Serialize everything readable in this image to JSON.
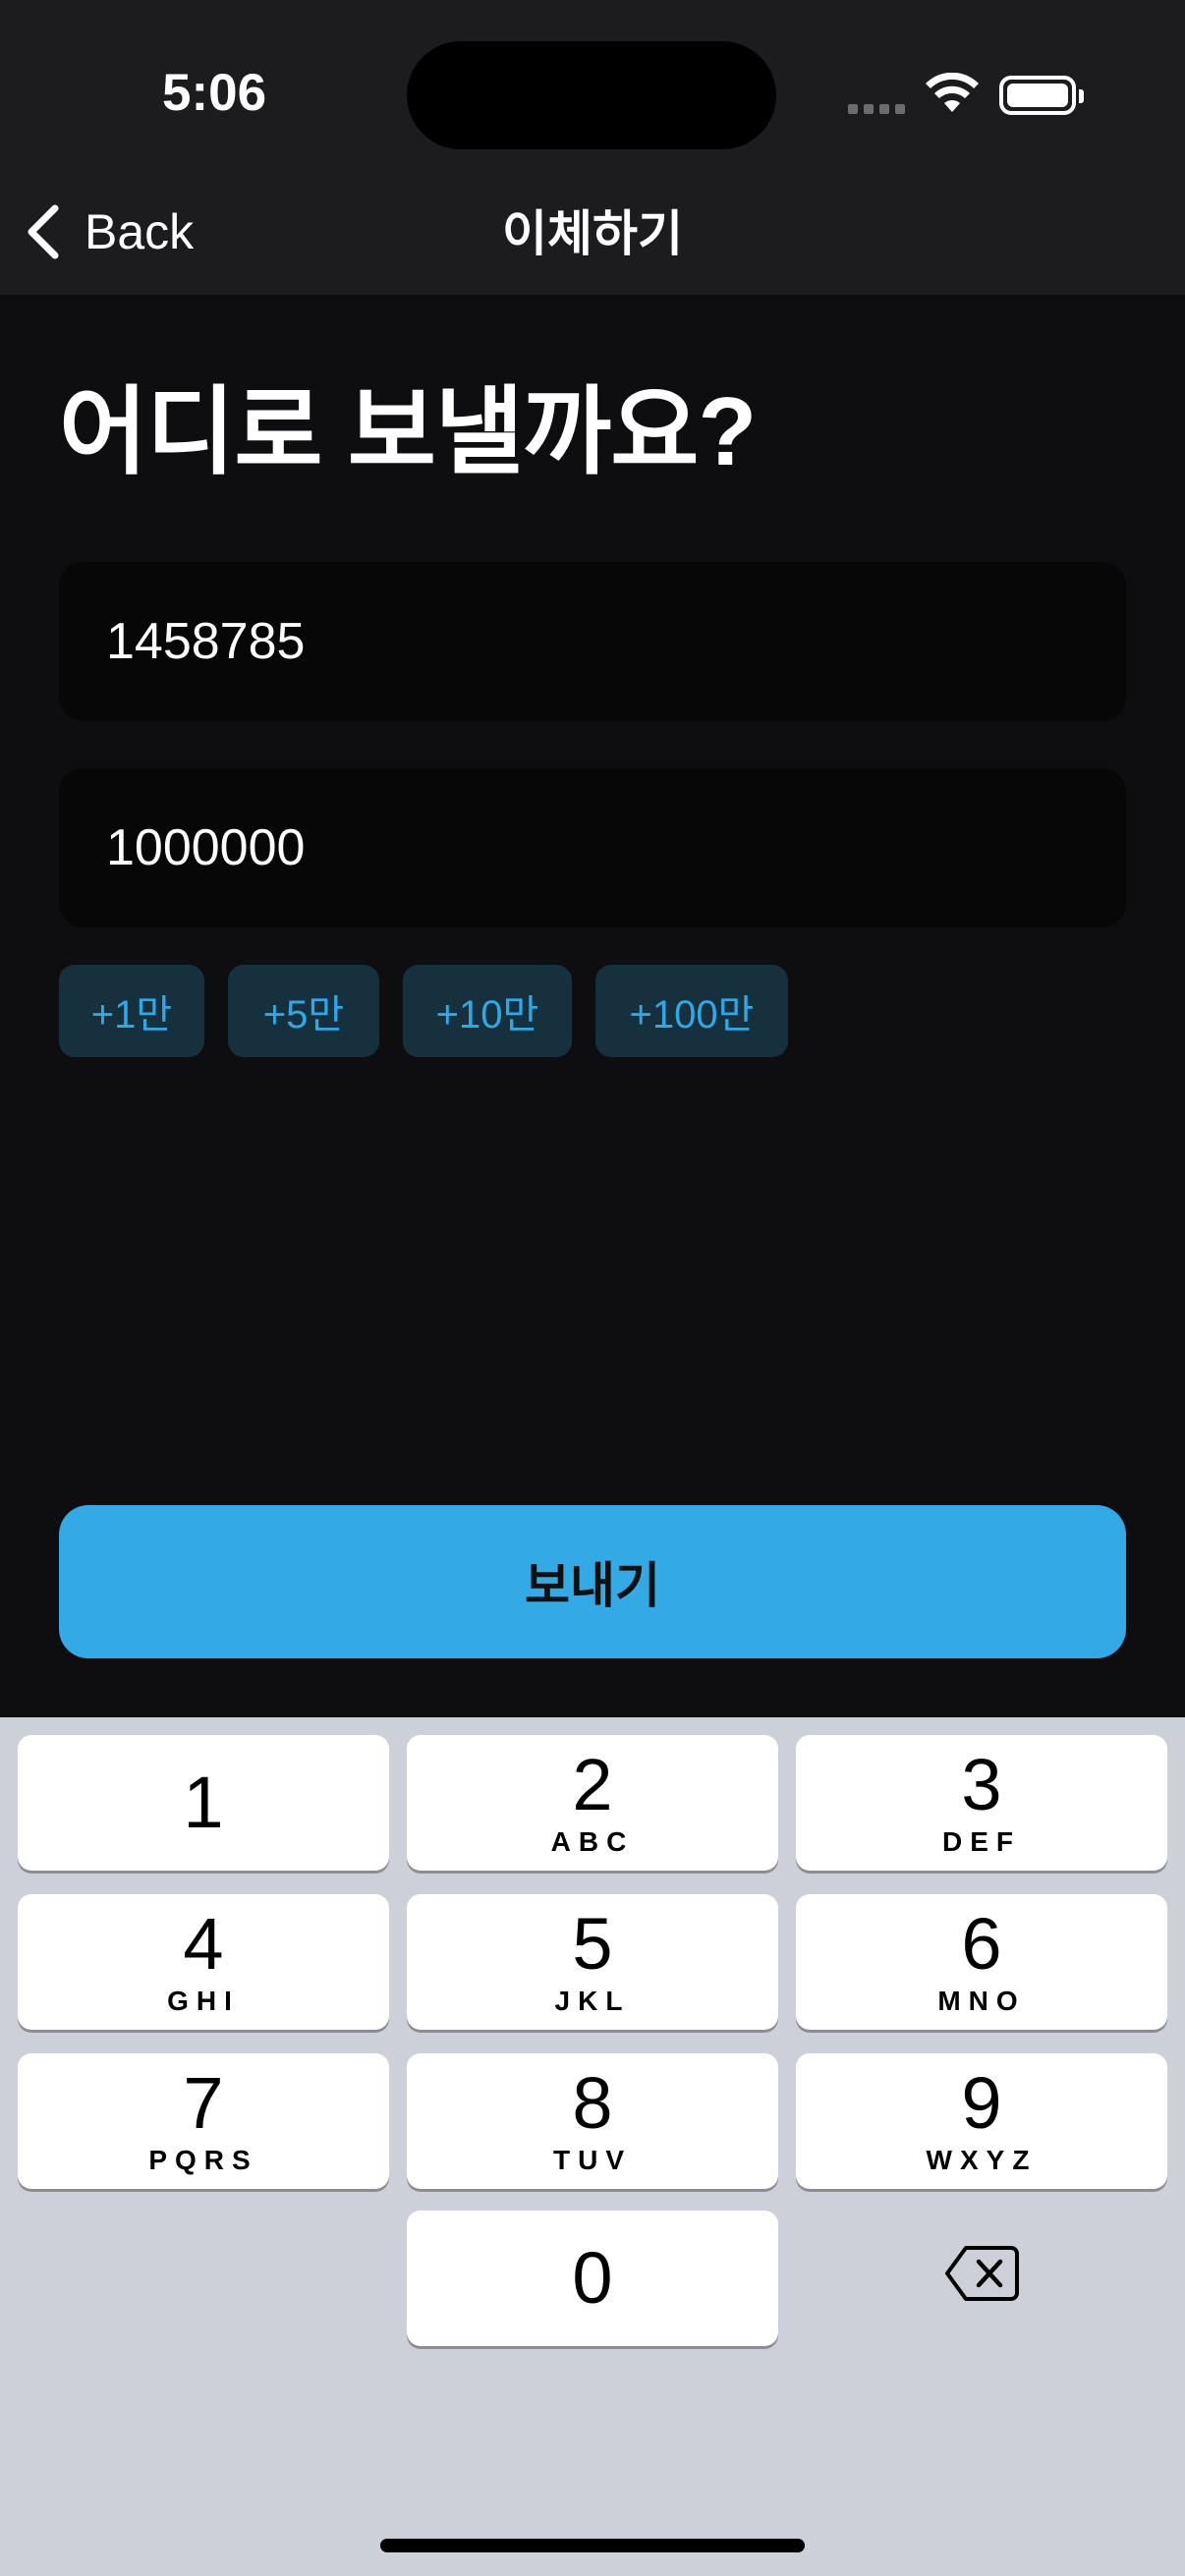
{
  "status_bar": {
    "time": "5:06"
  },
  "nav": {
    "back_label": "Back",
    "title": "이체하기"
  },
  "main": {
    "heading": "어디로 보낼까요?",
    "account_field": {
      "value": "1458785"
    },
    "amount_field": {
      "value": "1000000"
    },
    "quick_amounts": [
      "+1만",
      "+5만",
      "+10만",
      "+100만"
    ],
    "send_label": "보내기"
  },
  "keypad": {
    "keys": [
      {
        "digit": "1",
        "letters": ""
      },
      {
        "digit": "2",
        "letters": "ABC"
      },
      {
        "digit": "3",
        "letters": "DEF"
      },
      {
        "digit": "4",
        "letters": "GHI"
      },
      {
        "digit": "5",
        "letters": "JKL"
      },
      {
        "digit": "6",
        "letters": "MNO"
      },
      {
        "digit": "7",
        "letters": "PQRS"
      },
      {
        "digit": "8",
        "letters": "TUV"
      },
      {
        "digit": "9",
        "letters": "WXYZ"
      },
      {
        "digit": "0",
        "letters": ""
      }
    ]
  },
  "colors": {
    "accent": "#33a9e6",
    "chip_bg": "#16303d",
    "chip_text": "#2fa8e6",
    "background": "#0e0e10",
    "keyboard_bg": "#cdd0d8"
  }
}
